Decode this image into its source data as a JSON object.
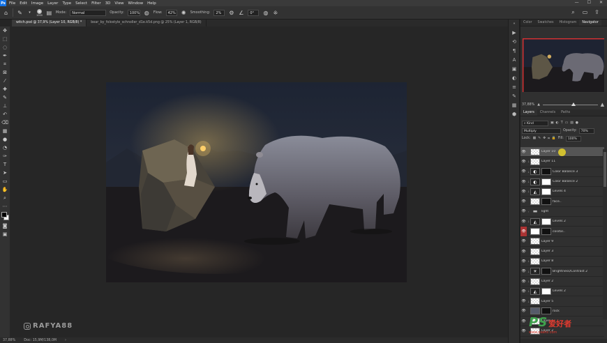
{
  "menubar": {
    "logo": "Ps",
    "items": [
      "File",
      "Edit",
      "Image",
      "Layer",
      "Type",
      "Select",
      "Filter",
      "3D",
      "View",
      "Window",
      "Help"
    ]
  },
  "options": {
    "brush_size": "1000",
    "mode_label": "Mode:",
    "mode_value": "Normal",
    "opacity_label": "Opacity:",
    "opacity_value": "100%",
    "flow_label": "Flow:",
    "flow_value": "42%",
    "smoothing_label": "Smoothing:",
    "smoothing_value": "2%",
    "angle_value": "0°"
  },
  "tabs": [
    {
      "label": "witch.psd @ 37,9% (Layer 10, RGB/8) *"
    },
    {
      "label": "bear_by_folostyle_schnoller_d1e.k5d.png @ 25% (Layer 1, RGB/8)"
    }
  ],
  "watermark": {
    "text": "RAFYA88"
  },
  "status": {
    "zoom": "37,88%",
    "doc": "Doc: 15,9M/138,0M"
  },
  "panel": {
    "top_tabs": [
      "Color",
      "Swatches",
      "Histogram",
      "Navigator"
    ],
    "navigator_zoom": "37,88%",
    "layer_tabs": [
      "Layers",
      "Channels",
      "Paths"
    ],
    "kind_label": "Kind",
    "blend_mode": "Multiply",
    "opacity_label": "Opacity:",
    "opacity_value": "70%",
    "lock_label": "Lock:",
    "fill_label": "Fill:",
    "fill_value": "100%"
  },
  "layers": [
    {
      "name": "Layer 10",
      "thumb": "check",
      "selected": true
    },
    {
      "name": "Layer 11",
      "thumb": "check"
    },
    {
      "name": "Color Balance 3",
      "thumb": "adj",
      "mask": "black"
    },
    {
      "name": "Color Balance 2",
      "thumb": "adj",
      "mask": "white"
    },
    {
      "name": "Levels 4",
      "thumb": "adj",
      "mask": "white"
    },
    {
      "name": "face..",
      "thumb": "adj",
      "mask": "black"
    },
    {
      "name": "light",
      "thumb": "folder"
    },
    {
      "name": "Levels 2",
      "thumb": "adj",
      "mask": "white"
    },
    {
      "name": "cosital..",
      "thumb": "white",
      "mask": "black",
      "red_eye": true
    },
    {
      "name": "Layer 9",
      "thumb": "check"
    },
    {
      "name": "Layer 3",
      "thumb": "check"
    },
    {
      "name": "Layer 8",
      "thumb": "check"
    },
    {
      "name": "Brightness/Contrast 2",
      "thumb": "adj",
      "mask": "black"
    },
    {
      "name": "Layer 2",
      "thumb": "check"
    },
    {
      "name": "Levels 2",
      "thumb": "adj",
      "mask": "white"
    },
    {
      "name": "Layer 5",
      "thumb": "check"
    },
    {
      "name": "rock",
      "thumb": "photo",
      "mask": "black"
    },
    {
      "name": "Layer 1",
      "thumb": "check"
    },
    {
      "name": "Layer 2",
      "thumb": "check"
    }
  ],
  "brand": {
    "ps": "PS",
    "cn": "爱好者",
    "url": "www.psahz.com"
  }
}
